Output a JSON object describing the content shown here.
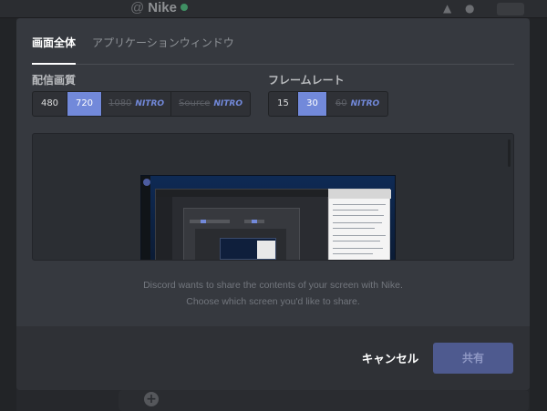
{
  "background": {
    "channel_prefix": "@",
    "channel_name": "Nike"
  },
  "modal": {
    "tabs": [
      {
        "label": "画面全体",
        "active": true
      },
      {
        "label": "アプリケーションウィンドウ",
        "active": false
      }
    ],
    "resolution": {
      "label": "配信画質",
      "options": [
        {
          "label": "480",
          "state": "normal"
        },
        {
          "label": "720",
          "state": "active"
        },
        {
          "label": "1080",
          "badge": "NITRO",
          "state": "locked"
        },
        {
          "label": "Source",
          "badge": "NITRO",
          "state": "locked"
        }
      ]
    },
    "framerate": {
      "label": "フレームレート",
      "options": [
        {
          "label": "15",
          "state": "normal"
        },
        {
          "label": "30",
          "state": "active"
        },
        {
          "label": "60",
          "badge": "NITRO",
          "state": "locked"
        }
      ]
    },
    "description": [
      "Discord wants to share the contents of your screen with Nike.",
      "Choose which screen you'd like to share."
    ],
    "cancel_label": "キャンセル",
    "share_label": "共有"
  },
  "colors": {
    "accent": "#7289da",
    "modal_bg": "#36393f",
    "footer_bg": "#2f3136",
    "share_disabled": "#4e5a8f"
  }
}
